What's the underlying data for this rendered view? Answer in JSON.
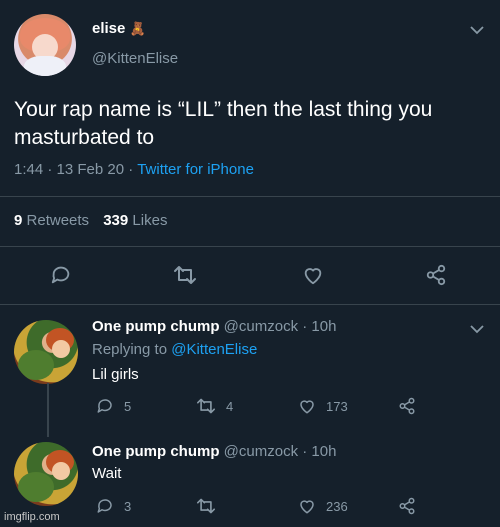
{
  "tweet": {
    "display_name": "elise",
    "name_emoji": "🧸",
    "handle": "@KittenElise",
    "text_line1": "Your rap name is “LIL” then the last thing you",
    "text_line2": "masturbated to",
    "time": "1:44",
    "date": "13 Feb 20",
    "dot": "·",
    "client": "Twitter for iPhone",
    "retweets_count": "9",
    "retweets_label": "Retweets",
    "likes_count": "339",
    "likes_label": "Likes"
  },
  "replies": [
    {
      "display_name": "One pump chump",
      "handle": "@cumzock",
      "age": "· 10h",
      "replying_label": "Replying to",
      "replying_handle": "@KittenElise",
      "text": "Lil girls",
      "replies": "5",
      "retweets": "4",
      "likes": "173"
    },
    {
      "display_name": "One pump chump",
      "handle": "@cumzock",
      "age": "· 10h",
      "text": "Wait",
      "replies": "3",
      "retweets": "",
      "likes": "236"
    }
  ],
  "watermark": "imgflip.com",
  "colors": {
    "background": "#15202b",
    "muted": "#8899a6",
    "link": "#1da1f2",
    "divider": "#38444d"
  }
}
